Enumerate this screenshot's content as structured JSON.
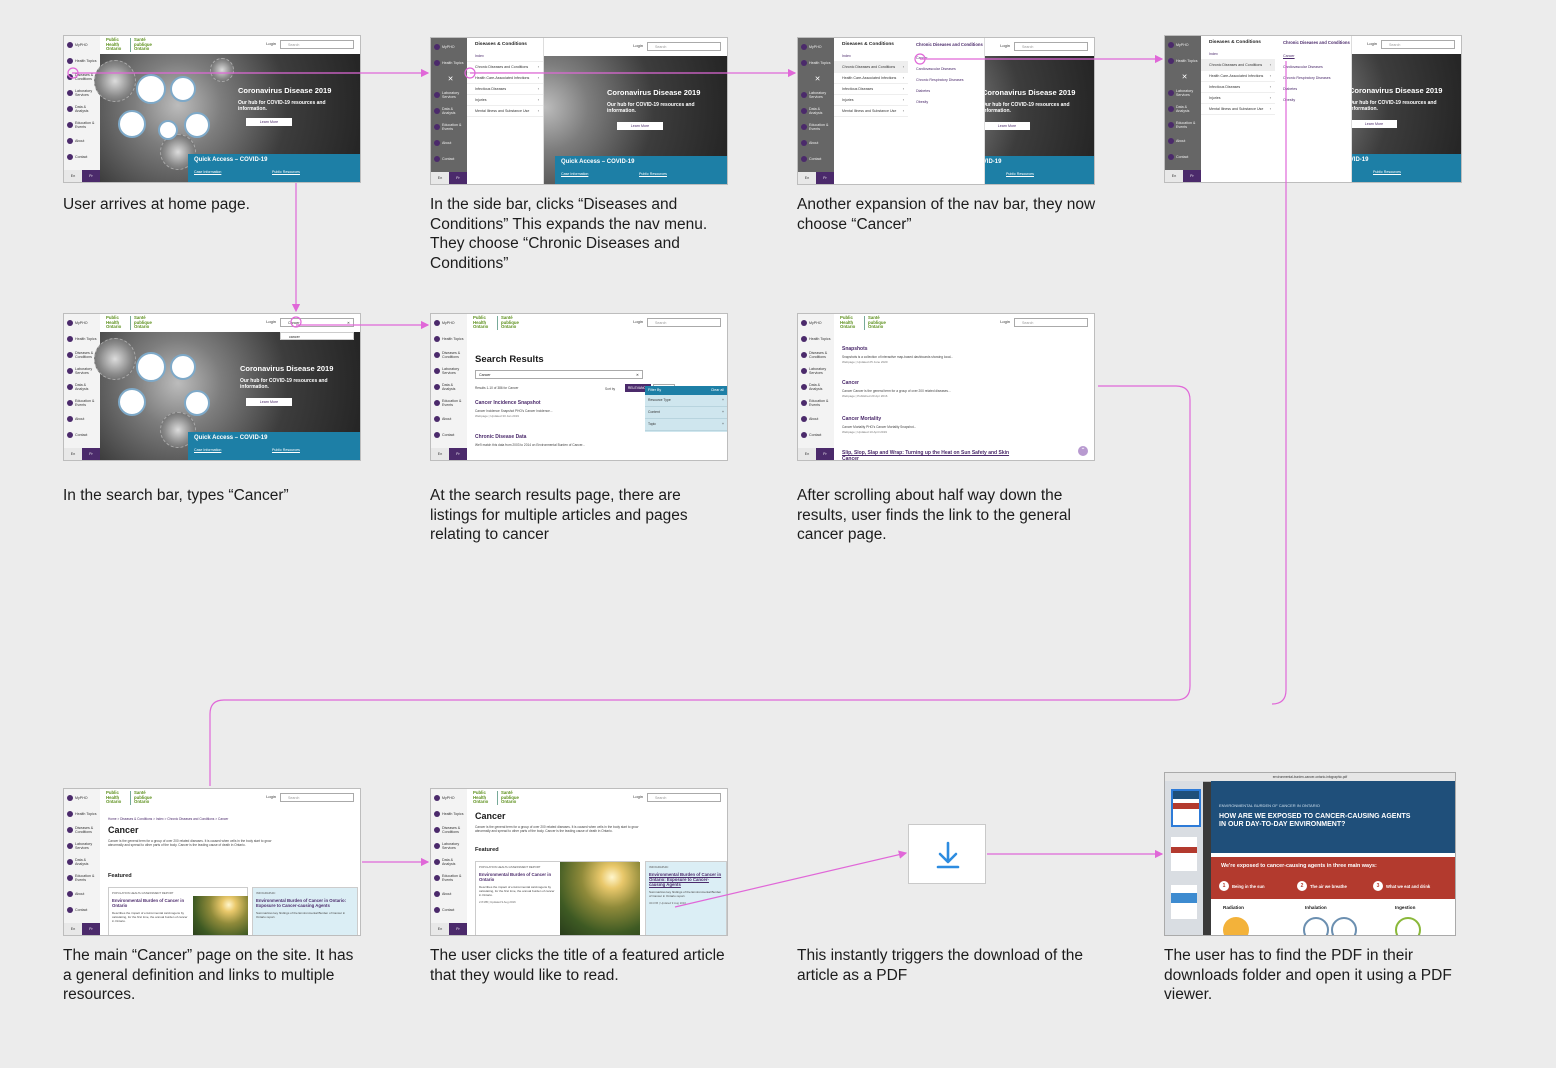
{
  "site": {
    "logo_en": [
      "Public",
      "Health",
      "Ontario"
    ],
    "logo_fr": [
      "Santé",
      "publique",
      "Ontario"
    ],
    "login": "Login",
    "search_placeholder": "Search",
    "sidebar_items": [
      "MyPHO",
      "Health Topics",
      "Diseases & Conditions",
      "Laboratory Services",
      "Data & Analysis",
      "Education & Events",
      "About",
      "Contact"
    ],
    "lang_en": "En",
    "lang_fr": "Fr"
  },
  "hero": {
    "title": "Coronavirus Disease 2019",
    "subtitle": "Our hub for COVID-19 resources and information.",
    "button": "Learn More",
    "quick_access": "Quick Access – COVID-19",
    "link1": "Case Information",
    "link2": "Public Resources"
  },
  "menu": {
    "title": "Diseases & Conditions",
    "index": "Index",
    "items": [
      "Chronic Diseases and Conditions",
      "Health Care-Associated Infections",
      "Infectious Diseases",
      "Injuries",
      "Mental Illness and Substance Use"
    ],
    "sub_title": "Chronic Diseases and Conditions",
    "sub_items": [
      "Cancer",
      "Cardiovascular Diseases",
      "Chronic Respiratory Diseases",
      "Diabetes",
      "Obesity"
    ]
  },
  "search": {
    "query": "Cancer",
    "suggestion": "cancer",
    "results_title": "Search Results",
    "results_count": "Results 1-10 of 386 for Cancer",
    "sort_by": "Sort by",
    "relevancy": "RELEVANCY",
    "date": "DATE",
    "filter_by": "Filter By",
    "clear_all": "Clear all",
    "filters": [
      "Resource Type",
      "Content",
      "Topic"
    ],
    "articles": [
      {
        "title": "Cancer Incidence Snapshot",
        "body": "Cancer Incidence Snapshot PHO's Cancer Incidence...",
        "meta": "Webpage | Updated 30 Jan 2019"
      },
      {
        "title": "Chronic Disease Data",
        "body": "We'll match this data from 2003 to 2014 on Environmental Burden of Cancer...",
        "meta": ""
      }
    ],
    "articles_b": [
      {
        "title": "Snapshots",
        "body": "Snapshots is a collection of interactive map-based dashboards showing local...",
        "meta": "Webpage | Updated 25 June 2020"
      },
      {
        "title": "Cancer",
        "body": "Cancer Cancer is the general term for a group of over 200 related diseases...",
        "meta": "Webpage | Published 20 Apr 2016"
      },
      {
        "title": "Cancer Mortality",
        "body": "Cancer Mortality PHO's Cancer Mortality Snapshot...",
        "meta": "Webpage | Updated 10 April 2019"
      },
      {
        "title": "Slip, Slop, Slap and Wrap: Turning up the Heat on Sun Safety and Skin Cancer",
        "body": "",
        "meta": ""
      }
    ]
  },
  "cancer_page": {
    "breadcrumb": "Home > Diseases & Conditions > Index > Chronic Diseases and Conditions > Cancer",
    "title": "Cancer",
    "description": "Cancer is the general term for a group of over 200 related diseases. It is caused when cells in the body start to grow abnormally and spread to other parts of the body. Cancer is the leading cause of death in Ontario.",
    "featured": "Featured",
    "card1_label": "Population Health Assessment Report",
    "card1_title": "Environmental Burden of Cancer in Ontario",
    "card1_body": "Describes the impact of environmental carcinogens by calculating, for the first time, the annual burden of cancer in Ontario.",
    "card1_meta": "2.8 MB | Updated 9 Aug 2016",
    "card2_label": "Infographic",
    "card2_title": "Environmental Burden of Cancer in Ontario: Exposure to Cancer-causing Agents",
    "card2_body": "Summarizes key findings of the Environmental Burden of Cancer in Ontario report.",
    "card2_meta": "324 KB | Updated 9 Aug 2016"
  },
  "pdf": {
    "window_title": "environmental-burden-cancer-ontario-infographic.pdf",
    "pre_title": "ENVIRONMENTAL BURDEN OF CANCER IN ONTARIO",
    "question": "HOW ARE WE EXPOSED TO CANCER-CAUSING AGENTS IN OUR DAY-TO-DAY ENVIRONMENT?",
    "red_title": "We're exposed to cancer-causing agents in three main ways:",
    "ways": [
      {
        "n": "1",
        "label": "Being in the sun"
      },
      {
        "n": "2",
        "label": "The air we breathe"
      },
      {
        "n": "3",
        "label": "What we eat and drink"
      }
    ],
    "categories": [
      "Radiation",
      "Inhalation",
      "Ingestion"
    ]
  },
  "captions": {
    "s1": "User arrives at home page.",
    "s2": " In the side bar, clicks “Diseases and Conditions” This expands the nav menu. They choose “Chronic Diseases and Conditions”",
    "s3": "Another expansion of the nav bar, they now choose “Cancer”",
    "s5": "In the search bar, types “Cancer”",
    "s6": "At the search results page, there are listings for multiple articles and pages relating to cancer",
    "s7": "After scrolling about half way down the results, user finds the link to the general cancer page.",
    "s9": "The main “Cancer” page on the site. It has a general definition and links to multiple resources.",
    "s10": "The user clicks the title of a featured article that they would like to read.",
    "s11": "This instantly triggers the download of the article as a PDF",
    "s12": "The user has to find the PDF in their downloads folder and open it using a PDF viewer."
  },
  "colors": {
    "flow_arrow": "#e067d8",
    "brand_purple": "#4b2a6b",
    "brand_green": "#5b8f1a",
    "accent_blue": "#1d7fa6",
    "download_icon": "#2d8ce0"
  },
  "icons": [
    "search-icon",
    "download-icon",
    "close-icon",
    "chevron-right-icon"
  ]
}
